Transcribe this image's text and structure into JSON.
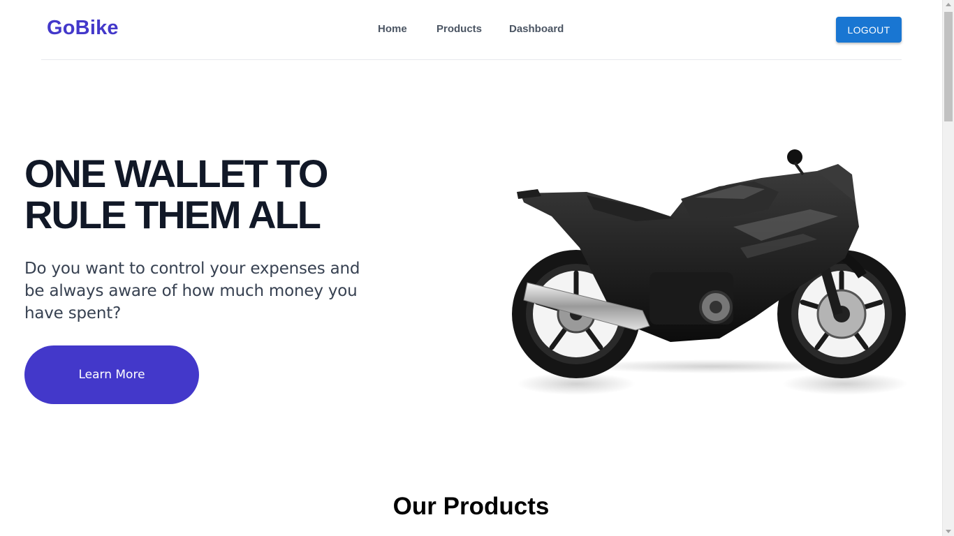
{
  "navbar": {
    "brand": "GoBike",
    "links": [
      "Home",
      "Products",
      "Dashboard"
    ],
    "logout_label": "LOGOUT"
  },
  "hero": {
    "title_line1": "ONE WALLET TO",
    "title_line2": "RULE THEM ALL",
    "description": "Do you want to control your expenses and be always aware of how much money you have spent?",
    "cta_label": "Learn More",
    "image": "motorcycle-image"
  },
  "products_section": {
    "title": "Our Products"
  },
  "colors": {
    "brand": "#4338ca",
    "logout_button": "#1976d2",
    "title_text": "#111827"
  }
}
